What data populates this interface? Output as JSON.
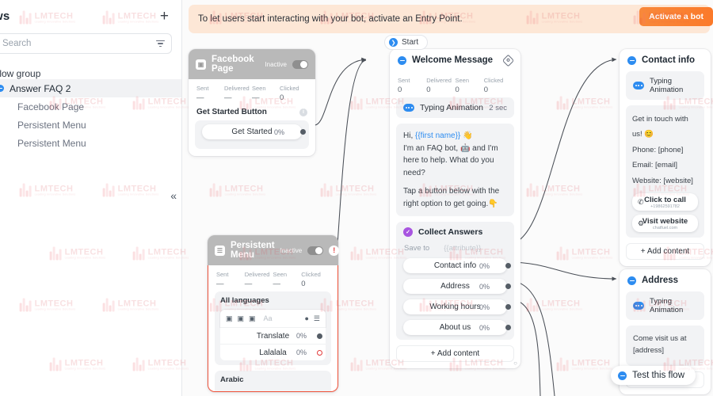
{
  "sidebar": {
    "title": "ws",
    "add_label": "+",
    "search": {
      "value": "",
      "placeholder": "Search"
    },
    "group_label": "Flow group",
    "items": [
      {
        "label": "Answer FAQ 2",
        "active": true
      },
      {
        "label": "Facebook Page",
        "active": false
      },
      {
        "label": "Persistent Menu",
        "active": false
      },
      {
        "label": "Persistent Menu",
        "active": false
      }
    ],
    "collapse_label": "«"
  },
  "banner": {
    "text": "To let users start interacting with your bot, activate an Entry Point.",
    "button_label": "Activate a bot"
  },
  "start_pill": {
    "label": "Start",
    "icon": "❯"
  },
  "facebook_card": {
    "title": "Facebook Page",
    "status_label": "Inactive",
    "stats": [
      {
        "key": "Sent",
        "value": "—"
      },
      {
        "key": "Delivered",
        "value": "—"
      },
      {
        "key": "Seen",
        "value": "—"
      },
      {
        "key": "Clicked",
        "value": "0"
      }
    ],
    "section_label": "Get Started Button",
    "button": {
      "label": "Get Started",
      "pct": "0%"
    }
  },
  "welcome_card": {
    "title": "Welcome Message",
    "stats": [
      {
        "key": "Sent",
        "value": "0"
      },
      {
        "key": "Delivered",
        "value": "0"
      },
      {
        "key": "Seen",
        "value": "0"
      },
      {
        "key": "Clicked",
        "value": "0"
      }
    ],
    "typing": {
      "label": "Typing Animation",
      "duration": "2 sec"
    },
    "message": {
      "line1_prefix": "Hi, ",
      "line1_var": "{{first name}}",
      "line1_suffix": " 👋",
      "line2": "I'm an FAQ bot, 🤖 and I'm here to help. What do you need?",
      "line3": "Tap a button below with the right option to get going.👇"
    },
    "collect": {
      "title": "Collect Answers",
      "save_to_label": "Save to",
      "save_to_value": "{{attribute}}",
      "buttons": [
        {
          "label": "Contact info",
          "pct": "0%"
        },
        {
          "label": "Address",
          "pct": "0%"
        },
        {
          "label": "Working hours",
          "pct": "0%"
        },
        {
          "label": "About us",
          "pct": "0%"
        }
      ]
    },
    "add_content_label": "+ Add content"
  },
  "persistent_menu_card": {
    "title": "Persistent Menu",
    "status_label": "Inactive",
    "warning_icon": "!",
    "stats": [
      {
        "key": "Sent",
        "value": "—"
      },
      {
        "key": "Delivered",
        "value": "—"
      },
      {
        "key": "Seen",
        "value": "—"
      },
      {
        "key": "Clicked",
        "value": "0"
      }
    ],
    "all_languages_label": "All languages",
    "composer_placeholder": "Aa",
    "buttons": [
      {
        "label": "Translate",
        "pct": "0%",
        "error": false
      },
      {
        "label": "Lalalala",
        "pct": "0%",
        "error": true
      }
    ],
    "arabic_label": "Arabic"
  },
  "contact_card": {
    "title": "Contact info",
    "typing_label": "Typing Animation",
    "lines": [
      "Get in touch with us! 😊",
      "Phone: [phone]",
      "Email: [email]",
      "Website: [website]"
    ],
    "actions": [
      {
        "label": "Click to call",
        "sub": "+19862591782",
        "icon": "✆"
      },
      {
        "label": "Visit website",
        "sub": "chatfuel.com",
        "icon": "⚙"
      }
    ],
    "add_content_label": "+ Add content"
  },
  "address_card": {
    "title": "Address",
    "typing_label": "Typing Animation",
    "message": "Come visit us at [address]",
    "add_content_label": "+ Add content"
  },
  "test_flow": {
    "label": "Test this flow"
  },
  "watermark": {
    "text": "LMTECH",
    "sub": "Leading Innovative Solutions"
  },
  "colors": {
    "accent_blue": "#2d8cf0",
    "banner_bg": "#fde7d6",
    "banner_btn": "#f8883b",
    "error_red": "#e23b3b",
    "purple": "#a855e0"
  }
}
